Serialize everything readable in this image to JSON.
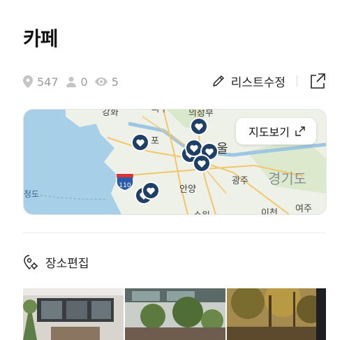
{
  "title": "카페",
  "stats": {
    "places": "547",
    "followers": "0",
    "views": "5"
  },
  "actions": {
    "edit_list": "리스트수정"
  },
  "map": {
    "open_label": "지도보기",
    "labels": {
      "gangwha": "강화",
      "pocheon": "파주",
      "uijeongbu": "의정부",
      "gimpo": "포",
      "seoul": "울",
      "gwangju": "광주",
      "gyeonggi": "경기도",
      "anyang": "안양",
      "suwon": "수원",
      "icheon": "이천",
      "yeoju": "여주",
      "route": "110",
      "west": "청도"
    }
  },
  "places": {
    "edit_label": "장소편집"
  }
}
